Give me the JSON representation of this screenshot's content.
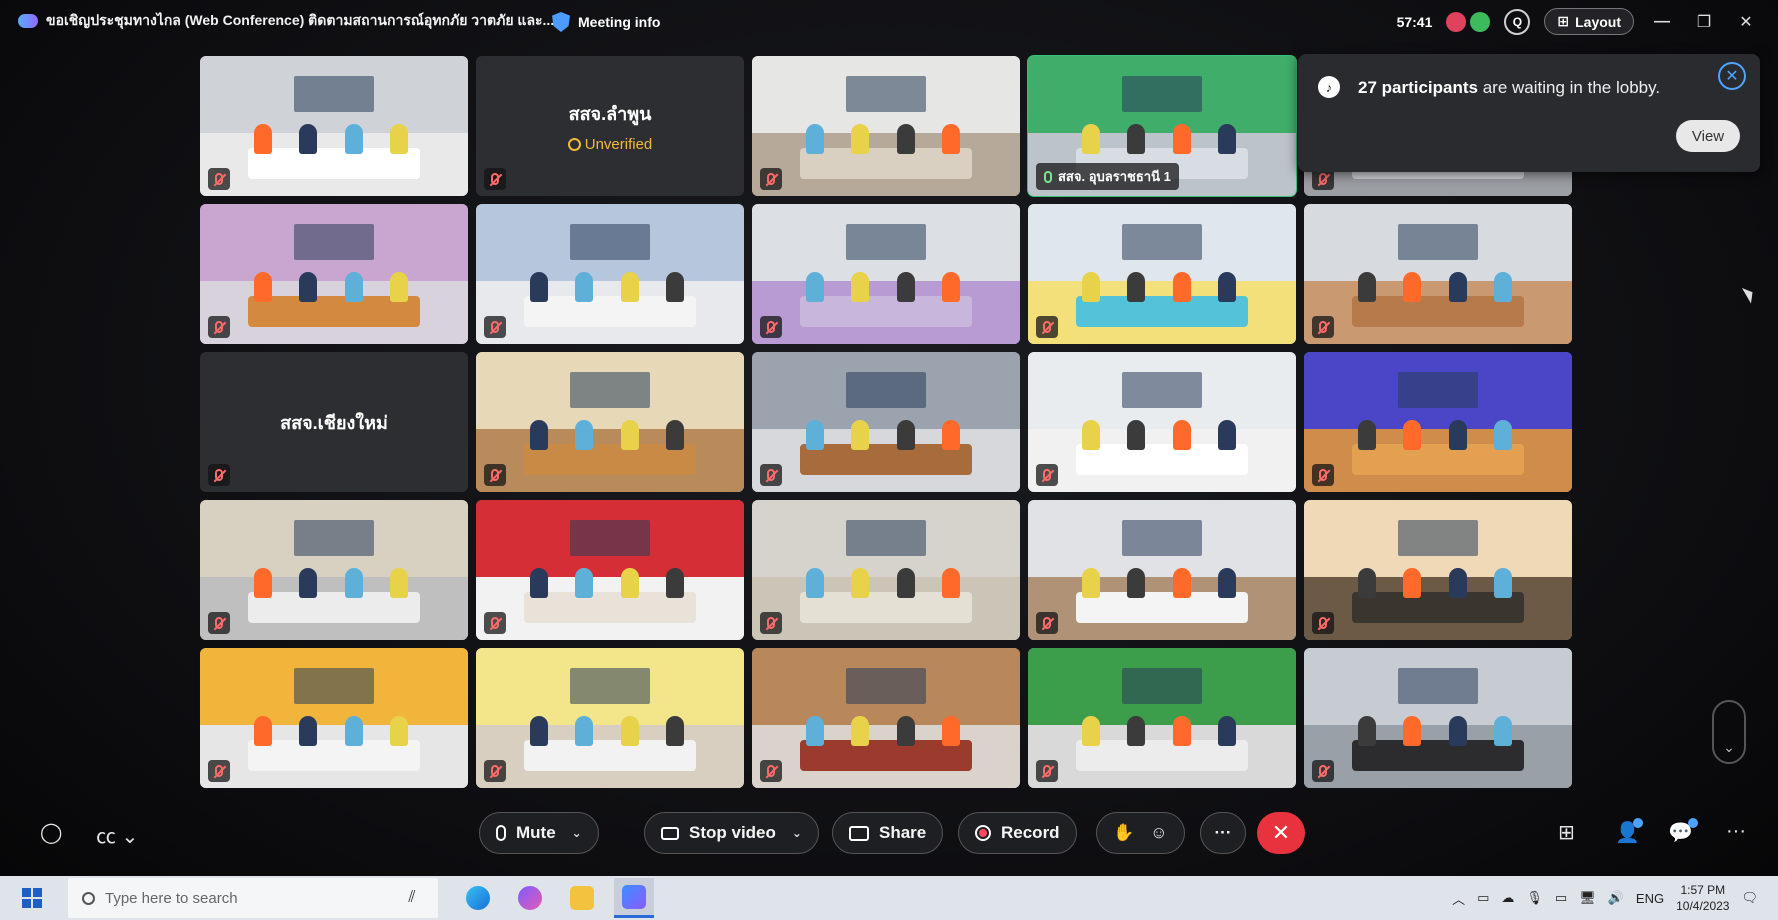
{
  "window": {
    "title": "ขอเชิญประชุมทางไกล (Web Conference) ติดตามสถานการณ์อุทกภัย วาตภัย และ...",
    "meeting_info": "Meeting info",
    "timer": "57:41",
    "layout_label": "Layout"
  },
  "lobby": {
    "count": "27 participants",
    "message": " are waiting in the lobby.",
    "view_label": "View"
  },
  "tiles": [
    {
      "kind": "video",
      "wall": "#cfd2d6",
      "floor": "#e9e9e9",
      "table": "#ffffff",
      "muted": true
    },
    {
      "kind": "blank",
      "name": "สสจ.ลำพูน",
      "status": "Unverified",
      "muted": true
    },
    {
      "kind": "video",
      "wall": "#e6e6e4",
      "floor": "#b7a99a",
      "table": "#d9d0c2",
      "muted": true
    },
    {
      "kind": "video",
      "wall": "#3fae6a",
      "floor": "#bcc3c9",
      "table": "#d7dde2",
      "label": "สสจ. อุบลราชธานี 1",
      "highlight": true
    },
    {
      "kind": "video",
      "wall": "#b9bdc3",
      "floor": "#9b9ea3",
      "table": "#cfd2d6",
      "muted": true
    },
    {
      "kind": "video",
      "wall": "#c9a6cf",
      "floor": "#d8d2dc",
      "table": "#d48a3e",
      "muted": true
    },
    {
      "kind": "video",
      "wall": "#b6c6dc",
      "floor": "#e7e9ec",
      "table": "#f4f4f4",
      "muted": true
    },
    {
      "kind": "video",
      "wall": "#dcdfe3",
      "floor": "#b99bd4",
      "table": "#c9b6dc",
      "muted": true
    },
    {
      "kind": "video",
      "wall": "#dfe6ec",
      "floor": "#f3e07a",
      "table": "#54c3d9",
      "muted": true
    },
    {
      "kind": "video",
      "wall": "#d7dbe0",
      "floor": "#c99a72",
      "table": "#b67a4b",
      "muted": true
    },
    {
      "kind": "blank",
      "name": "สสจ.เชียงใหม่",
      "muted": true
    },
    {
      "kind": "video",
      "wall": "#e7d9b8",
      "floor": "#b98a5a",
      "table": "#c98a46",
      "muted": true
    },
    {
      "kind": "video",
      "wall": "#9aa3ae",
      "floor": "#d6d8dc",
      "table": "#a86b3c",
      "muted": true
    },
    {
      "kind": "video",
      "wall": "#e9ecef",
      "floor": "#f1f1f1",
      "table": "#ffffff",
      "muted": true
    },
    {
      "kind": "video",
      "wall": "#4b46c8",
      "floor": "#cf8c4a",
      "table": "#e2a050",
      "muted": true
    },
    {
      "kind": "video",
      "wall": "#d8d1c2",
      "floor": "#bfbfbf",
      "table": "#ececec",
      "muted": true
    },
    {
      "kind": "video",
      "wall": "#d62e36",
      "floor": "#f2f2f2",
      "table": "#e8e2d8",
      "muted": true
    },
    {
      "kind": "video",
      "wall": "#d6d3cc",
      "floor": "#cbc5b8",
      "table": "#e5e0d4",
      "muted": true
    },
    {
      "kind": "video",
      "wall": "#e0e2e6",
      "floor": "#b09277",
      "table": "#f4f4f4",
      "muted": true
    },
    {
      "kind": "video",
      "wall": "#efd9b6",
      "floor": "#6d5a46",
      "table": "#3b3530",
      "muted": true
    },
    {
      "kind": "video",
      "wall": "#f0b53a",
      "floor": "#e6e6e6",
      "table": "#f4f4f4",
      "muted": true
    },
    {
      "kind": "video",
      "wall": "#f3e58a",
      "floor": "#d9cfc1",
      "table": "#f2f2f2",
      "muted": true
    },
    {
      "kind": "video",
      "wall": "#b9875c",
      "floor": "#d9d3cb",
      "table": "#9b3b2e",
      "muted": true
    },
    {
      "kind": "video",
      "wall": "#3c9e4b",
      "floor": "#d9d9d9",
      "table": "#ececec",
      "muted": true
    },
    {
      "kind": "video",
      "wall": "#c7ccd2",
      "floor": "#9aa0a7",
      "table": "#2c2c2e",
      "muted": true
    }
  ],
  "controls": {
    "mute": "Mute",
    "stop_video": "Stop video",
    "share": "Share",
    "record": "Record"
  },
  "taskbar": {
    "search_placeholder": "Type here to search",
    "lang": "ENG",
    "time": "1:57 PM",
    "date": "10/4/2023"
  }
}
